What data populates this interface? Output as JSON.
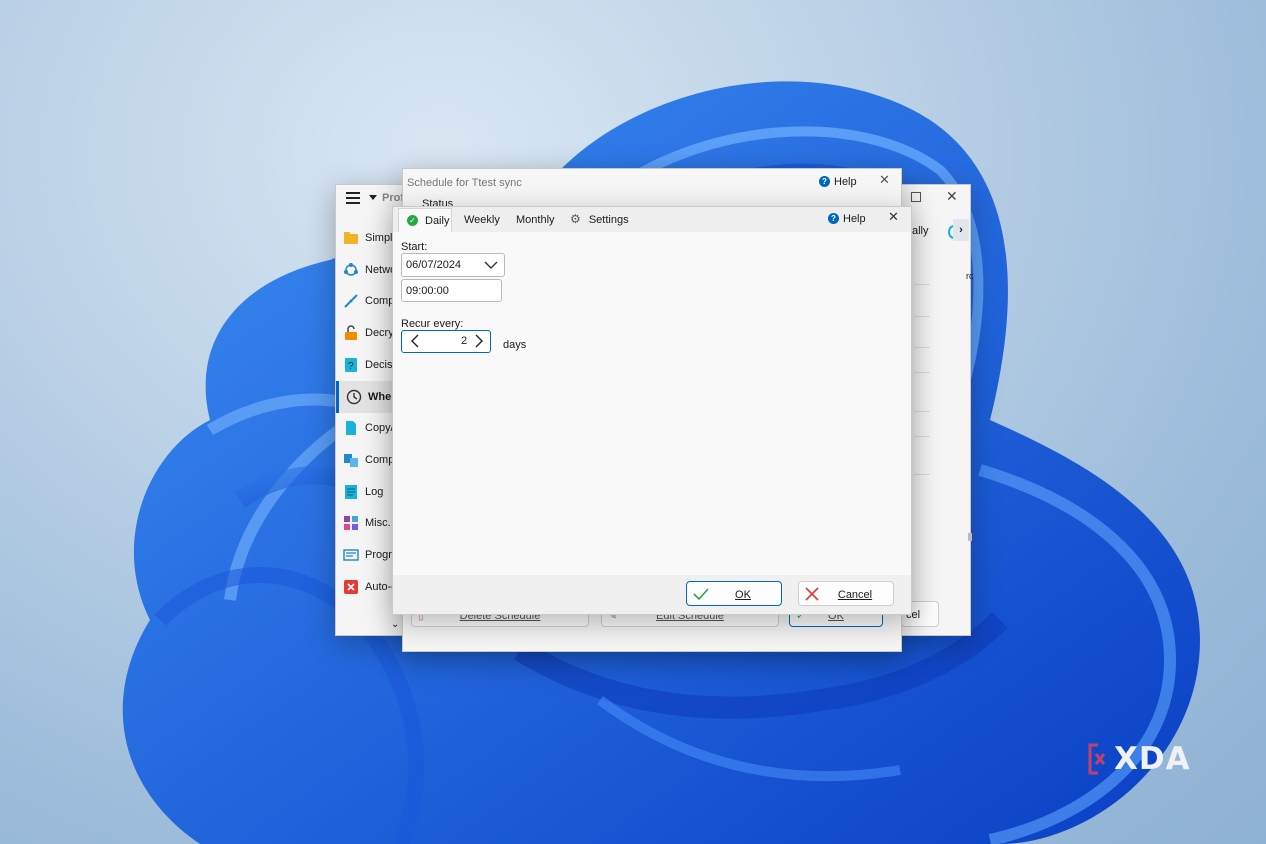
{
  "main_window": {
    "profile_label": "Profi",
    "header_right": "ally",
    "header_right2": "rc",
    "sidebar": [
      {
        "label": "Simple",
        "icon": "folder-icon",
        "color": "#f0b429"
      },
      {
        "label": "Netwo",
        "icon": "network-icon",
        "color": "#1e88c8"
      },
      {
        "label": "Compr",
        "icon": "compress-icon",
        "color": "#1e88c8"
      },
      {
        "label": "Decryp",
        "icon": "unlock-icon",
        "color": "#f08c00"
      },
      {
        "label": "Decisio",
        "icon": "question-icon",
        "color": "#19b3d9"
      },
      {
        "label": "When",
        "icon": "clock-icon",
        "color": "#333333"
      },
      {
        "label": "Copy/D",
        "icon": "document-icon",
        "color": "#19b3d9"
      },
      {
        "label": "Compa",
        "icon": "compare-icon",
        "color": "#1e88c8"
      },
      {
        "label": "Log",
        "icon": "log-icon",
        "color": "#19b3d9"
      },
      {
        "label": "Misc.",
        "icon": "misc-icon",
        "color": "#8e44ad"
      },
      {
        "label": "Progra",
        "icon": "program-icon",
        "color": "#1e88c8"
      },
      {
        "label": "Auto-c",
        "icon": "close-box-icon",
        "color": "#e53935"
      }
    ],
    "cancel_partial": "cel"
  },
  "schedule_window": {
    "title": "Schedule for Ttest sync",
    "help_label": "Help",
    "status_label": "Status",
    "delete_label": "Delete Schedule",
    "edit_label": "Edit Schedule",
    "ok_label": "OK"
  },
  "dialog": {
    "tabs": [
      {
        "label": "Daily"
      },
      {
        "label": "Weekly"
      },
      {
        "label": "Monthly"
      },
      {
        "label": "Settings"
      }
    ],
    "help_label": "Help",
    "start_label": "Start:",
    "date_value": "06/07/2024",
    "time_value": "09:00:00",
    "recur_label": "Recur every:",
    "recur_value": "2",
    "days_label": "days",
    "ok_label": "OK",
    "cancel_label": "Cancel"
  },
  "watermark": "XDA",
  "colors": {
    "accent": "#0067c0",
    "check_green": "#27a844",
    "cancel_red": "#e53935"
  }
}
